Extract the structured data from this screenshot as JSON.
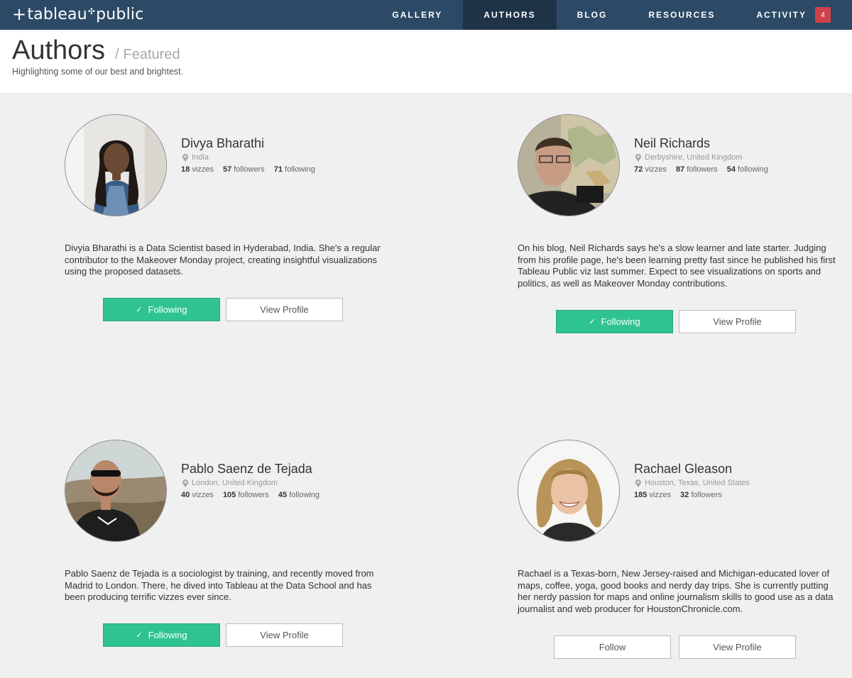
{
  "brand": {
    "logo_text": "tableau",
    "logo_text2": "public"
  },
  "nav": {
    "items": [
      {
        "label": "GALLERY"
      },
      {
        "label": "AUTHORS"
      },
      {
        "label": "BLOG"
      },
      {
        "label": "RESOURCES"
      },
      {
        "label": "ACTIVITY"
      }
    ],
    "activity_badge": "4",
    "active": "AUTHORS"
  },
  "header": {
    "title": "Authors",
    "separator": "/",
    "crumb": "Featured",
    "subtitle": "Highlighting some of our best and brightest."
  },
  "authors": [
    {
      "name": "Divya Bharathi",
      "location": "India",
      "vizzes": "18",
      "vizzes_label": "vizzes",
      "followers": "57",
      "followers_label": "followers",
      "following": "71",
      "following_label": "following",
      "bio": "Divyia Bharathi is a Data Scientist based in Hyderabad, India. She's a regular contributor to the Makeover Monday project, creating insightful visualizations using the proposed datasets.",
      "follow_label": "Following",
      "profile_label": "View Profile"
    },
    {
      "name": "Neil Richards",
      "location": "Derbyshire, United Kingdom",
      "vizzes": "72",
      "vizzes_label": "vizzes",
      "followers": "87",
      "followers_label": "followers",
      "following": "54",
      "following_label": "following",
      "bio": "On his blog, Neil Richards says he's a slow learner and late starter. Judging from his profile page, he's been learning pretty fast since he published his first Tableau Public viz last summer. Expect to see visualizations on sports and politics, as well as Makeover Monday contributions.",
      "follow_label": "Following",
      "profile_label": "View Profile"
    },
    {
      "name": "Pablo Saenz de Tejada",
      "location": "London, United Kingdom",
      "vizzes": "40",
      "vizzes_label": "vizzes",
      "followers": "105",
      "followers_label": "followers",
      "following": "45",
      "following_label": "following",
      "bio": "Pablo Saenz de Tejada is a sociologist by training, and recently moved from Madrid to London. There, he dived into Tableau at the Data School and has been producing terrific vizzes ever since.",
      "follow_label": "Following",
      "profile_label": "View Profile"
    },
    {
      "name": "Rachael Gleason",
      "location": "Houston, Texas, United States",
      "vizzes": "185",
      "vizzes_label": "vizzes",
      "followers": "32",
      "followers_label": "followers",
      "bio": "Rachael is a Texas-born, New Jersey-raised and Michigan-educated lover of maps, coffee, yoga, good books and nerdy day trips. She is currently putting her nerdy passion for maps and online journalism skills to good use as a data journalist and web producer for HoustonChronicle.com.",
      "follow_label": "Follow",
      "profile_label": "View Profile"
    }
  ],
  "colors": {
    "nav_bg": "#2c4a66",
    "nav_active": "#1f3347",
    "badge": "#d0404a",
    "following_green": "#2fc391",
    "page_bg": "#f0f0f0"
  }
}
